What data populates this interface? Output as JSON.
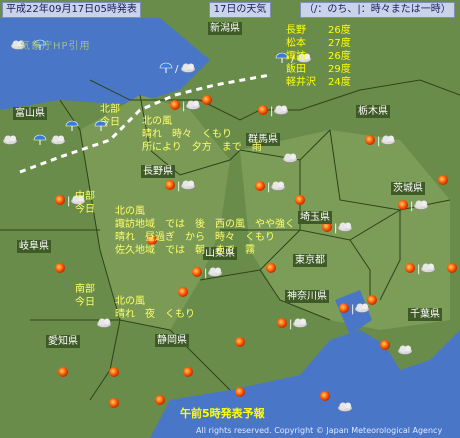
{
  "header": {
    "issued": "平成22年09月17日05時発表",
    "day": "17日の天気",
    "legend": "（/：のち、|：時々または一時）"
  },
  "watermark": "気象庁HP引用",
  "prefectures": {
    "niigata": "新潟県",
    "toyama": "富山県",
    "nagano": "長野県",
    "gunma": "群馬県",
    "tochigi": "栃木県",
    "ibaraki": "茨城県",
    "saitama": "埼玉県",
    "gifu": "岐阜県",
    "yamanashi": "山梨県",
    "tokyo": "東京都",
    "kanagawa": "神奈川県",
    "chiba": "千葉県",
    "aichi": "愛知県",
    "shizuoka": "静岡県"
  },
  "temperatures": [
    {
      "city": "長野",
      "temp": "26度"
    },
    {
      "city": "松本",
      "temp": "27度"
    },
    {
      "city": "諏訪",
      "temp": "26度"
    },
    {
      "city": "飯田",
      "temp": "29度"
    },
    {
      "city": "軽井沢",
      "temp": "24度"
    }
  ],
  "forecasts": {
    "north": {
      "region": "北部",
      "day": "今日",
      "lines": [
        "北の風",
        "晴れ　時々　くもり",
        "所により　夕方　まで　雨"
      ]
    },
    "central": {
      "region": "中部",
      "day": "今日",
      "lines": [
        "北の風",
        "諏訪地域　では　後　西の風　やや強く",
        "晴れ　昼過ぎ　から　時々　くもり",
        "佐久地域　では　朝　まで　霧"
      ]
    },
    "south": {
      "region": "南部",
      "day": "今日",
      "lines": [
        "北の風",
        "晴れ　夜　くもり"
      ]
    }
  },
  "footer": "午前5時発表予報",
  "copyright": "All rights reserved. Copyright © Japan Meteorological Agency",
  "icons": [
    "sun-icon",
    "cloud-icon",
    "sun-cloud-icon",
    "umbrella-icon"
  ],
  "colors": {
    "land": "#6a8c4a",
    "sea": "#4a76c8",
    "text": "#ffff66",
    "label_bg": "#3e5a26"
  }
}
